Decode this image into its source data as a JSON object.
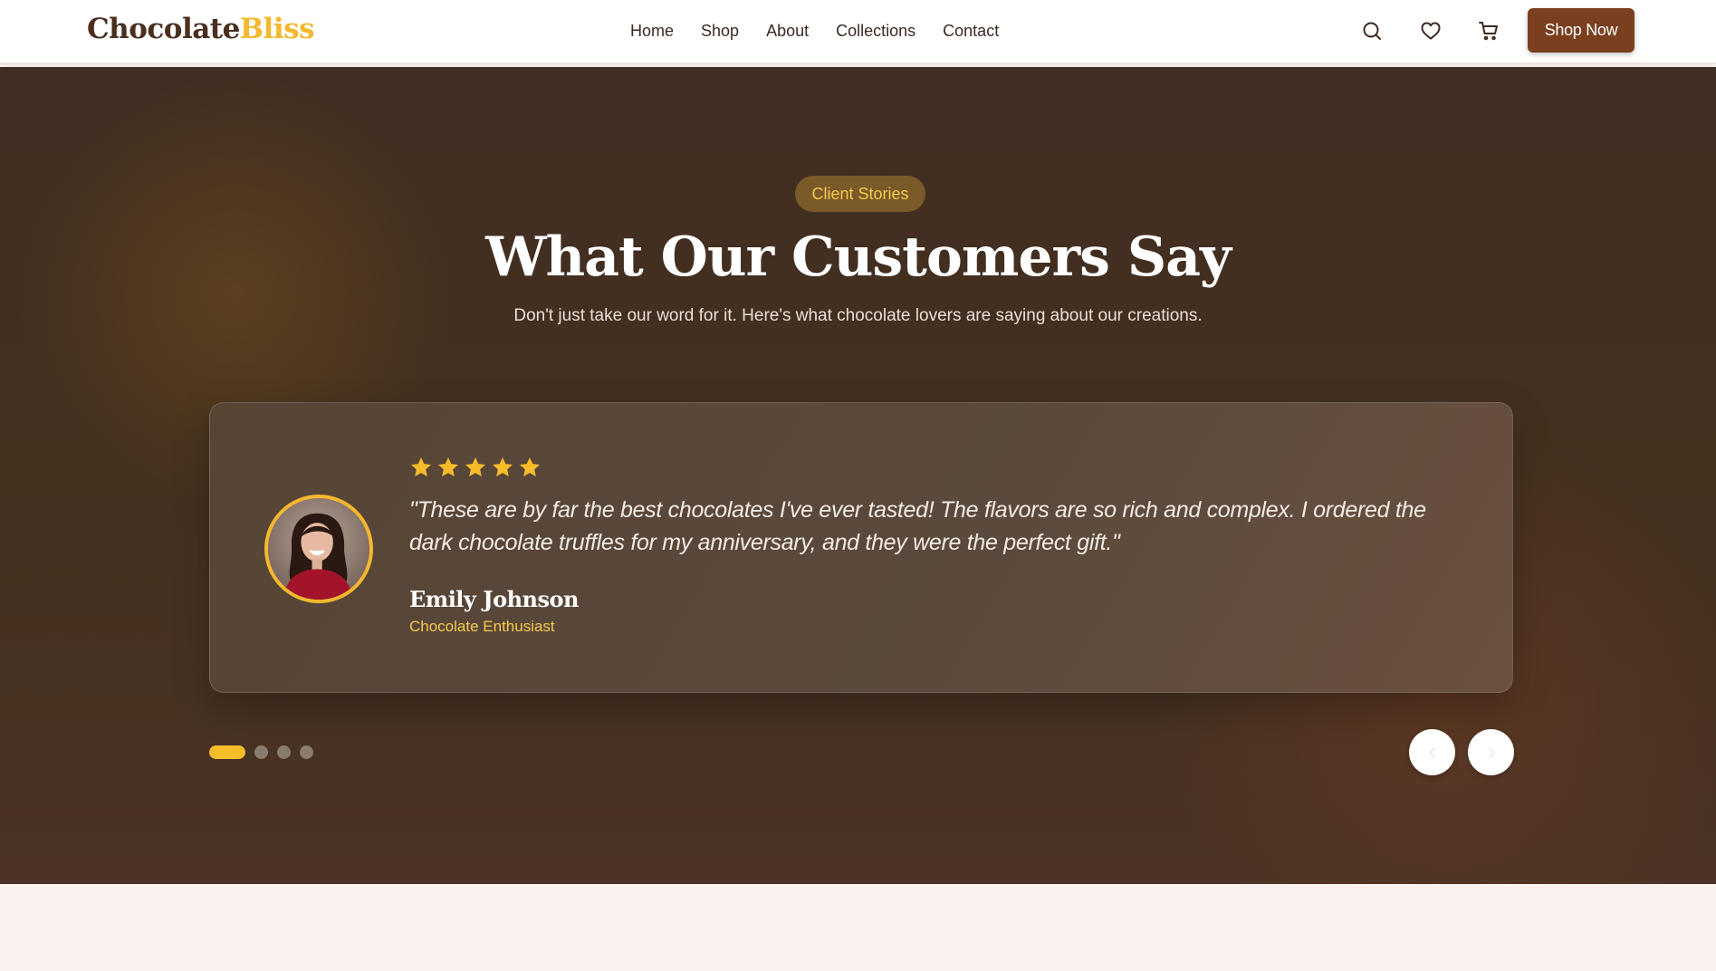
{
  "header": {
    "logo_part1": "Chocolate",
    "logo_part2": "Bliss",
    "nav": [
      "Home",
      "Shop",
      "About",
      "Collections",
      "Contact"
    ],
    "icons": [
      "search-icon",
      "heart-icon",
      "cart-icon"
    ],
    "cta_label": "Shop Now"
  },
  "testimonials": {
    "badge": "Client Stories",
    "title": "What Our Customers Say",
    "subtitle": "Don't just take our word for it. Here's what chocolate lovers are saying about our creations.",
    "active": {
      "rating": 5,
      "quote": "\"These are by far the best chocolates I've ever tasted! The flavors are so rich and complex. I ordered the dark chocolate truffles for my anniversary, and they were the perfect gift.\"",
      "name": "Emily Johnson",
      "role": "Chocolate Enthusiast"
    },
    "slide_count": 4,
    "active_index": 0
  },
  "colors": {
    "brand_brown": "#7a3f1e",
    "accent_gold": "#f5b82e",
    "hero_bg": "#43301f"
  }
}
